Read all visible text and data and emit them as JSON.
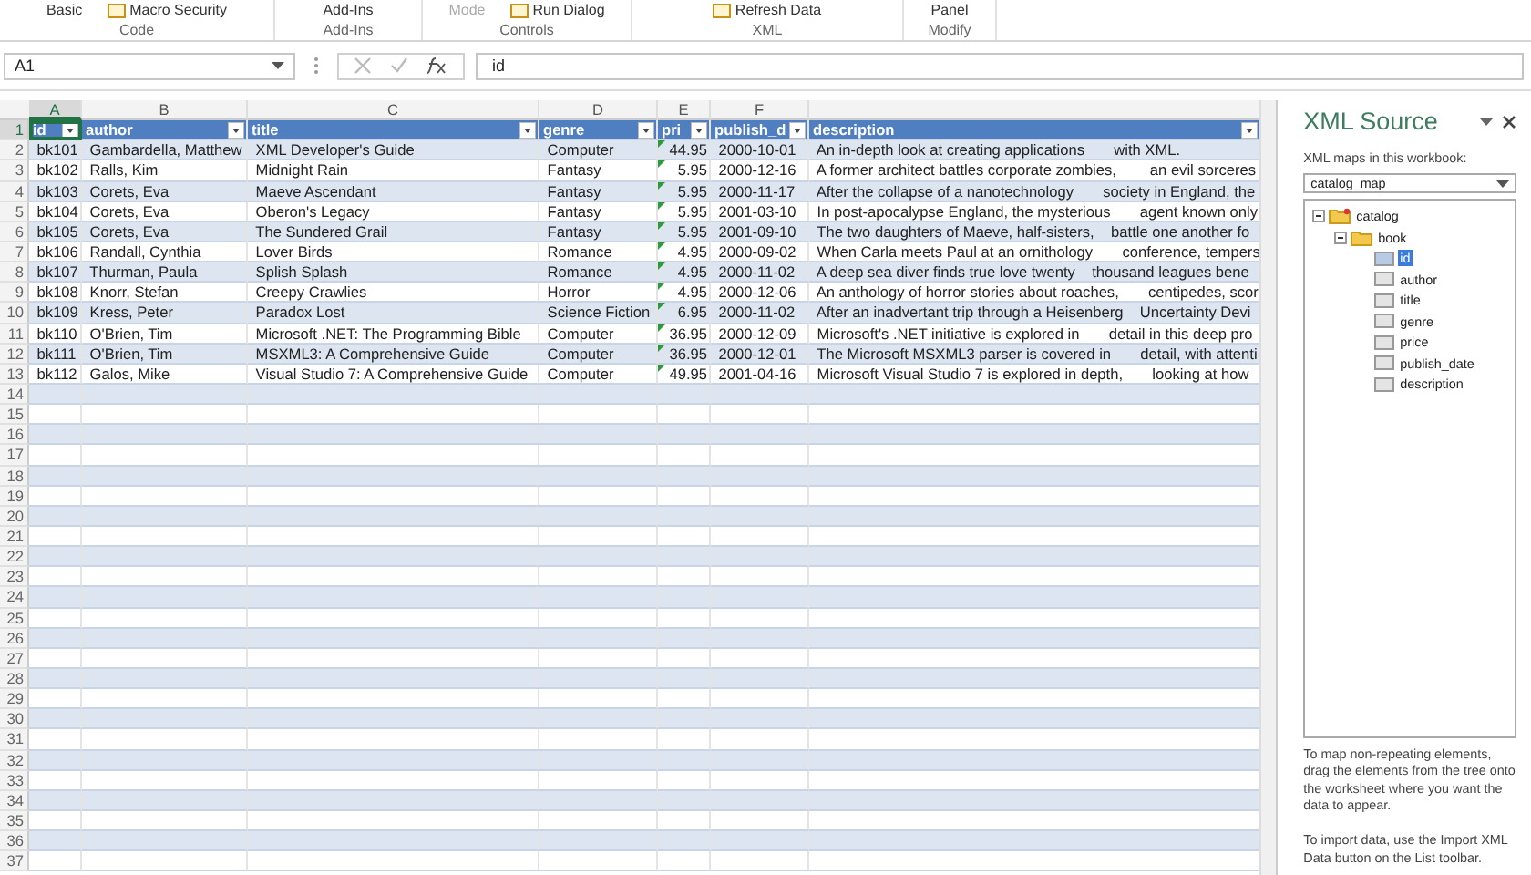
{
  "ribbon": {
    "groups": [
      {
        "label": "Code",
        "items": [
          {
            "text": "Basic",
            "icon": false,
            "disabled": false
          },
          {
            "text": "Macro Security",
            "icon": true,
            "disabled": false
          }
        ]
      },
      {
        "label": "Add-Ins",
        "items": [
          {
            "text": "Add-Ins",
            "icon": false,
            "disabled": false
          }
        ]
      },
      {
        "label": "Controls",
        "items": [
          {
            "text": "Mode",
            "icon": false,
            "disabled": true
          },
          {
            "text": "Run Dialog",
            "icon": true,
            "disabled": false
          }
        ]
      },
      {
        "label": "XML",
        "items": [
          {
            "text": "Refresh Data",
            "icon": true,
            "disabled": false
          }
        ]
      },
      {
        "label": "Modify",
        "items": [
          {
            "text": "Panel",
            "icon": false,
            "disabled": false
          }
        ]
      }
    ]
  },
  "formula_bar": {
    "name_box": "A1",
    "value": "id"
  },
  "sheet": {
    "columns": [
      {
        "letter": "A",
        "selected": true
      },
      {
        "letter": "B",
        "selected": false
      },
      {
        "letter": "C",
        "selected": false
      },
      {
        "letter": "D",
        "selected": false
      },
      {
        "letter": "E",
        "selected": false
      },
      {
        "letter": "F",
        "selected": false
      }
    ],
    "headers": [
      "id",
      "author",
      "title",
      "genre",
      "pri",
      "publish_d",
      "description"
    ],
    "rows": [
      {
        "id": "bk101",
        "author": "Gambardella, Matthew",
        "title": "XML Developer's Guide",
        "genre": "Computer",
        "price": "44.95",
        "price_flagged": true,
        "date": "2000-10-01",
        "description": "An in-depth look at creating applications       with XML."
      },
      {
        "id": "bk102",
        "author": "Ralls, Kim",
        "title": "Midnight Rain",
        "genre": "Fantasy",
        "price": "5.95",
        "price_flagged": true,
        "date": "2000-12-16",
        "description": "A former architect battles corporate zombies,        an evil sorceres"
      },
      {
        "id": "bk103",
        "author": "Corets, Eva",
        "title": "Maeve Ascendant",
        "genre": "Fantasy",
        "price": "5.95",
        "price_flagged": true,
        "date": "2000-11-17",
        "description": "After the collapse of a nanotechnology       society in England, the"
      },
      {
        "id": "bk104",
        "author": "Corets, Eva",
        "title": "Oberon's Legacy",
        "genre": "Fantasy",
        "price": "5.95",
        "price_flagged": true,
        "date": "2001-03-10",
        "description": "In post-apocalypse England, the mysterious       agent known only"
      },
      {
        "id": "bk105",
        "author": "Corets, Eva",
        "title": "The Sundered Grail",
        "genre": "Fantasy",
        "price": "5.95",
        "price_flagged": true,
        "date": "2001-09-10",
        "description": "The two daughters of Maeve, half-sisters,    battle one another fo"
      },
      {
        "id": "bk106",
        "author": "Randall, Cynthia",
        "title": "Lover Birds",
        "genre": "Romance",
        "price": "4.95",
        "price_flagged": true,
        "date": "2000-09-02",
        "description": "When Carla meets Paul at an ornithology       conference, tempers"
      },
      {
        "id": "bk107",
        "author": "Thurman, Paula",
        "title": "Splish Splash",
        "genre": "Romance",
        "price": "4.95",
        "price_flagged": true,
        "date": "2000-11-02",
        "description": "A deep sea diver finds true love twenty    thousand leagues bene"
      },
      {
        "id": "bk108",
        "author": "Knorr, Stefan",
        "title": "Creepy Crawlies",
        "genre": "Horror",
        "price": "4.95",
        "price_flagged": true,
        "date": "2000-12-06",
        "description": "An anthology of horror stories about roaches,       centipedes, scor"
      },
      {
        "id": "bk109",
        "author": "Kress, Peter",
        "title": "Paradox Lost",
        "genre": "Science Fiction",
        "price": "6.95",
        "price_flagged": true,
        "date": "2000-11-02",
        "description": "After an inadvertant trip through a Heisenberg    Uncertainty Devi"
      },
      {
        "id": "bk110",
        "author": "O'Brien, Tim",
        "title": "Microsoft .NET: The Programming Bible",
        "genre": "Computer",
        "price": "36.95",
        "price_flagged": true,
        "date": "2000-12-09",
        "description": "Microsoft's .NET initiative is explored in       detail in this deep pro"
      },
      {
        "id": "bk111",
        "author": "O'Brien, Tim",
        "title": "MSXML3: A Comprehensive Guide",
        "genre": "Computer",
        "price": "36.95",
        "price_flagged": true,
        "date": "2000-12-01",
        "description": "The Microsoft MSXML3 parser is covered in       detail, with attenti"
      },
      {
        "id": "bk112",
        "author": "Galos, Mike",
        "title": "Visual Studio 7: A Comprehensive Guide",
        "genre": "Computer",
        "price": "49.95",
        "price_flagged": true,
        "date": "2001-04-16",
        "description": "Microsoft Visual Studio 7 is explored in depth,       looking at how"
      }
    ],
    "row_numbers": [
      "1",
      "2",
      "3",
      "4",
      "5",
      "6",
      "7",
      "8",
      "9",
      "10",
      "11",
      "12",
      "13",
      "14",
      "15",
      "16",
      "17",
      "18",
      "19",
      "20",
      "21",
      "22",
      "23",
      "24",
      "25",
      "26",
      "27",
      "28",
      "29",
      "30",
      "31",
      "32",
      "33",
      "34",
      "35",
      "36",
      "37"
    ]
  },
  "xml_source": {
    "title": "XML Source",
    "maps_label": "XML maps in this workbook:",
    "selected_map": "catalog_map",
    "tree": [
      {
        "label": "catalog",
        "kind": "root",
        "selected": false,
        "children": [
          {
            "label": "book",
            "kind": "folder",
            "selected": false,
            "children": [
              {
                "label": "id",
                "kind": "element",
                "selected": true
              },
              {
                "label": "author",
                "kind": "element",
                "selected": false
              },
              {
                "label": "title",
                "kind": "element",
                "selected": false
              },
              {
                "label": "genre",
                "kind": "element",
                "selected": false
              },
              {
                "label": "price",
                "kind": "element",
                "selected": false
              },
              {
                "label": "publish_date",
                "kind": "element",
                "selected": false
              },
              {
                "label": "description",
                "kind": "element",
                "selected": false
              }
            ]
          }
        ]
      }
    ],
    "help": [
      "To map non-repeating elements, drag the elements from the tree onto the worksheet where you want the data to appear.",
      "To import data, use the Import XML Data button on the List toolbar."
    ]
  }
}
